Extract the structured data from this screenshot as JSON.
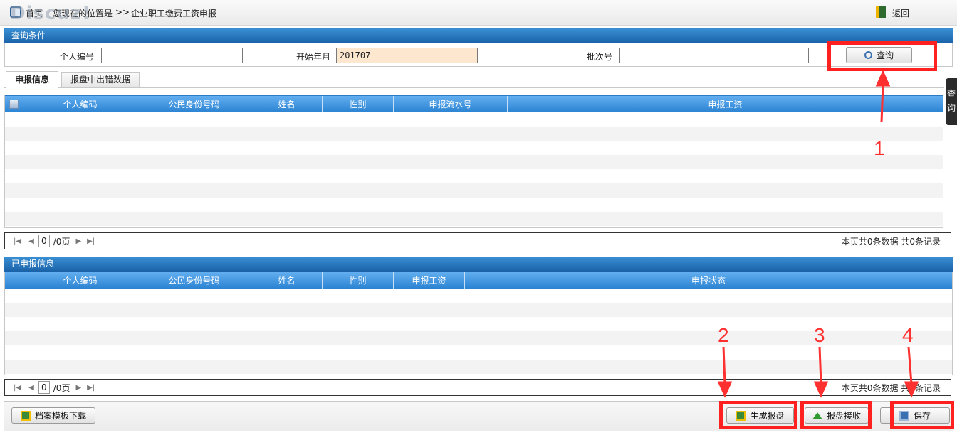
{
  "topbar": {
    "home": "首页",
    "location": "您现在的位置是",
    "sep": ">>",
    "page": "企业职工缴费工资申报",
    "back": "返回",
    "watermark": "Discuz!"
  },
  "query": {
    "section_title": "查询条件",
    "id_label": "个人编号",
    "id_value": "",
    "start_label": "开始年月",
    "start_value": "201707",
    "batch_label": "批次号",
    "batch_value": "",
    "search_button": "查询"
  },
  "side_tab": {
    "line1": "查",
    "line2": "询"
  },
  "tabs": [
    {
      "label": "申报信息",
      "active": true
    },
    {
      "label": "报盘中出错数据",
      "active": false
    }
  ],
  "table1": {
    "columns": [
      "个人编码",
      "公民身份号码",
      "姓名",
      "性别",
      "申报流水号",
      "申报工资"
    ],
    "rows": []
  },
  "pager1": {
    "page": "0",
    "total": "/0页",
    "summary": "本页共0条数据 共0条记录"
  },
  "table2": {
    "section_title": "已申报信息",
    "columns": [
      "个人编码",
      "公民身份号码",
      "姓名",
      "性别",
      "申报工资",
      "申报状态"
    ],
    "rows": []
  },
  "pager2": {
    "page": "0",
    "total": "/0页",
    "summary": "本页共0条数据 共0条记录"
  },
  "footer": {
    "template_download": "档案模板下载",
    "generate": "生成报盘",
    "receive": "报盘接收",
    "save": "保存"
  },
  "annotations": [
    "1",
    "2",
    "3",
    "4"
  ],
  "colors": {
    "header_blue": "#1a62a8",
    "table_header_blue": "#2b83d2",
    "highlight_red": "#ff2020",
    "date_field_bg": "#fde7cf"
  }
}
